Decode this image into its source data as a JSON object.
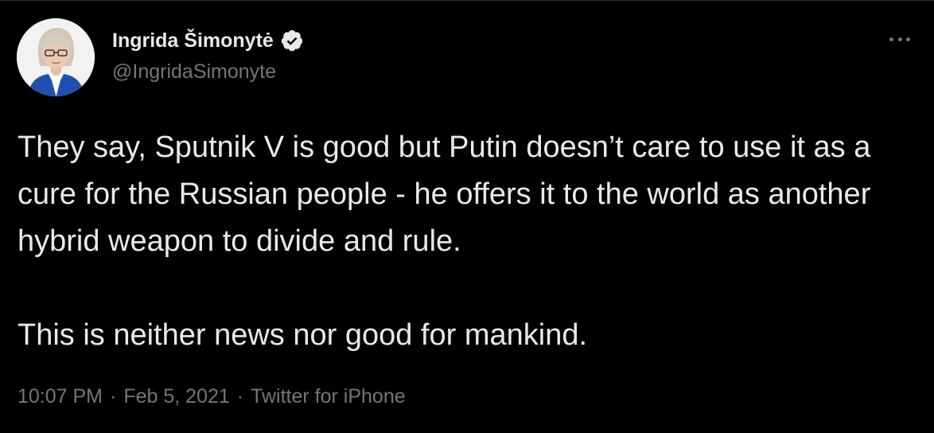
{
  "tweet": {
    "author": {
      "display_name": "Ingrida Šimonytė",
      "handle": "@IngridaSimonyte",
      "verified": true,
      "avatar_icon": "profile-photo"
    },
    "more_icon": "more-horizontal-icon",
    "paragraphs": [
      "They say, Sputnik V is good but Putin doesn’t care to use it as a cure for the Russian people - he offers it to the world as another hybrid weapon to divide and rule.",
      "This is neither news nor good for mankind."
    ],
    "time": "10:07 PM",
    "date": "Feb 5, 2021",
    "source": "Twitter for iPhone",
    "separator": "·"
  },
  "colors": {
    "background": "#000000",
    "primary_text": "#e7e9ea",
    "secondary_text": "#71767b",
    "verified_badge": "#e7e9ea"
  }
}
